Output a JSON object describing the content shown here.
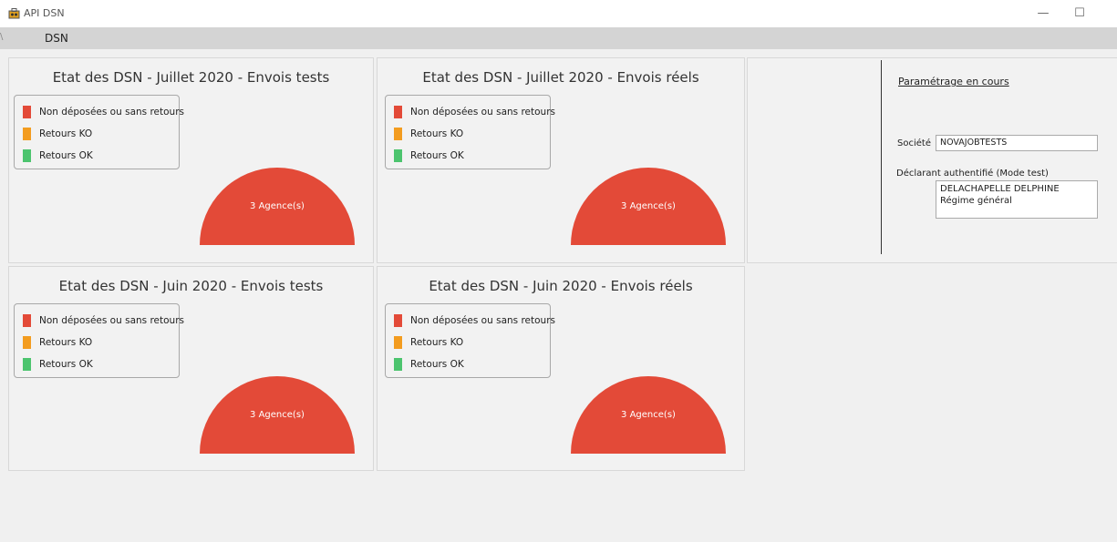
{
  "window": {
    "title": "API DSN",
    "min_glyph": "—",
    "max_glyph": "☐"
  },
  "menu": {
    "items": [
      {
        "label": "DSN"
      }
    ]
  },
  "legend": [
    {
      "label": "Non déposées ou sans retours",
      "color": "#e34a38"
    },
    {
      "label": "Retours KO",
      "color": "#f39c1f"
    },
    {
      "label": "Retours OK",
      "color": "#4cc46e"
    }
  ],
  "panels": [
    {
      "title": "Etat des DSN - Juillet 2020 - Envois tests",
      "gauge_label": "3 Agence(s)"
    },
    {
      "title": "Etat des DSN - Juillet 2020 - Envois réels",
      "gauge_label": "3 Agence(s)"
    },
    {
      "title": "Etat des DSN - Juin 2020 - Envois tests",
      "gauge_label": "3 Agence(s)"
    },
    {
      "title": "Etat des DSN - Juin 2020 - Envois réels",
      "gauge_label": "3 Agence(s)"
    }
  ],
  "settings": {
    "link": "Paramétrage en cours",
    "company_label": "Société",
    "company_value": "NOVAJOBTESTS",
    "declarant_label": "Déclarant authentifié (Mode test)",
    "declarant_line1": "DELACHAPELLE DELPHINE",
    "declarant_line2": "Régime général"
  },
  "colors": {
    "gauge": "#e34a38"
  }
}
